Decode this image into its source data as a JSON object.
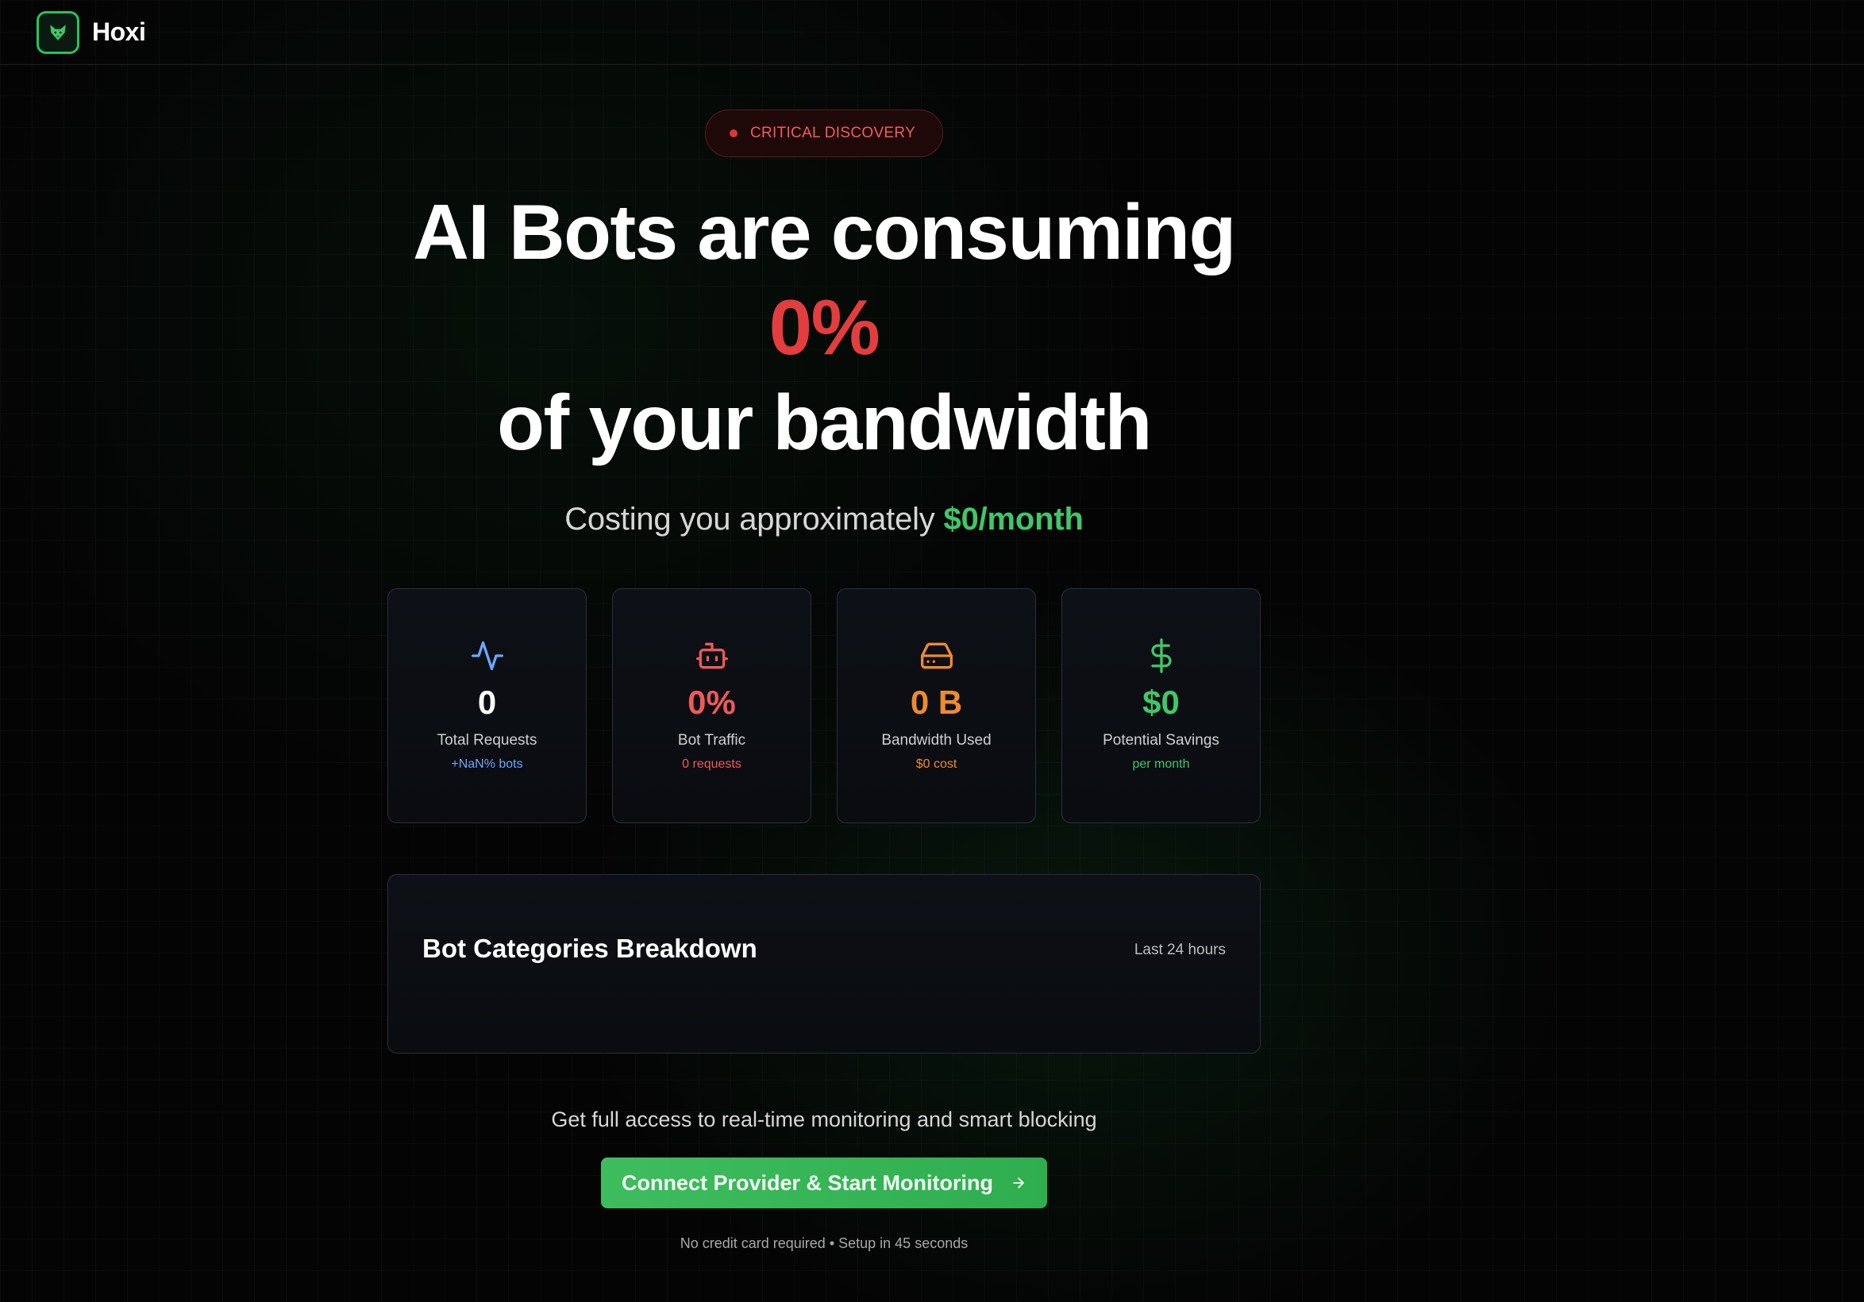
{
  "header": {
    "brand": "Hoxi",
    "logo_icon": "fox-icon"
  },
  "hero": {
    "badge": "CRITICAL DISCOVERY",
    "headline_line1": "AI Bots are consuming",
    "headline_percent": "0%",
    "headline_line2": "of your bandwidth",
    "subline_prefix": "Costing you approximately",
    "subline_cost": "$0/month"
  },
  "stats": [
    {
      "icon": "activity-icon",
      "value": "0",
      "label": "Total Requests",
      "sub": "+NaN% bots",
      "color": "#6ba7ff"
    },
    {
      "icon": "bot-icon",
      "value": "0%",
      "label": "Bot Traffic",
      "sub": "0 requests",
      "color": "#ee5a5a"
    },
    {
      "icon": "hard-drive-icon",
      "value": "0 B",
      "label": "Bandwidth Used",
      "sub": "$0 cost",
      "color": "#f08a2e"
    },
    {
      "icon": "dollar-icon",
      "value": "$0",
      "label": "Potential Savings",
      "sub": "per month",
      "color": "#3fc768"
    }
  ],
  "breakdown": {
    "title": "Bot Categories Breakdown",
    "range": "Last 24 hours"
  },
  "cta": {
    "text": "Get full access to real-time monitoring and smart blocking",
    "button_label": "Connect Provider & Start Monitoring",
    "button_icon": "arrow-right-icon",
    "note": "No credit card required • Setup in 45 seconds"
  }
}
